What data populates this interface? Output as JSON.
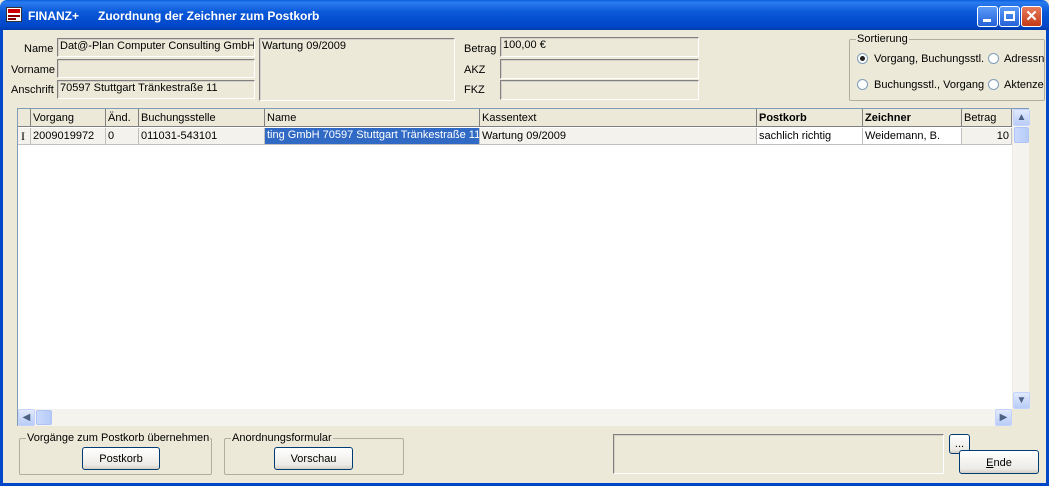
{
  "window": {
    "app_name": "FINANZ+",
    "title": "Zuordnung der Zeichner zum Postkorb",
    "close_glyph": "✕"
  },
  "header": {
    "name_label": "Name",
    "name_value": "Dat@-Plan Computer Consulting GmbH",
    "vorname_label": "Vorname",
    "vorname_value": "",
    "anschrift_label": "Anschrift",
    "anschrift_value": "70597 Stuttgart  Tränkestraße 11",
    "kassentext_value": "Wartung 09/2009",
    "betrag_label": "Betrag",
    "betrag_value": "100,00 €",
    "akz_label": "AKZ",
    "akz_value": "",
    "fkz_label": "FKZ",
    "fkz_value": ""
  },
  "sortierung": {
    "title": "Sortierung",
    "options": [
      {
        "label": "Vorgang, Buchungsstl.",
        "selected": true
      },
      {
        "label": "Adressn",
        "selected": false
      },
      {
        "label": "Buchungsstl., Vorgang",
        "selected": false
      },
      {
        "label": "Aktenze",
        "selected": false
      }
    ]
  },
  "grid": {
    "columns": [
      "Vorgang",
      "Änd.",
      "Buchungsstelle",
      "Name",
      "Kassentext",
      "Postkorb",
      "Zeichner",
      "Betrag"
    ],
    "rows": [
      {
        "indicator": "I",
        "vorgang": "2009019972",
        "aend": "0",
        "buchungsstelle": "011031-543101",
        "name": "ting GmbH 70597 Stuttgart Tränkestraße 11",
        "kassentext": "Wartung 09/2009",
        "postkorb": "sachlich richtig",
        "zeichner": "Weidemann, B.",
        "betrag": "10"
      }
    ]
  },
  "footer": {
    "group1_title": "Vorgänge zum Postkorb übernehmen",
    "postkorb_button": "Postkorb",
    "group2_title": "Anordnungsformular",
    "vorschau_button": "Vorschau",
    "status_value": "",
    "ellipsis_button": "...",
    "ende_button": "Ende"
  },
  "colors": {
    "titlebar": "#0046C8",
    "selection": "#316AC5",
    "background": "#ECE9D8"
  }
}
